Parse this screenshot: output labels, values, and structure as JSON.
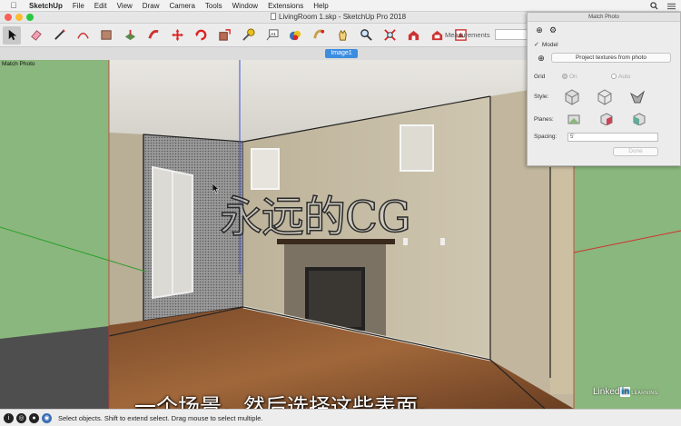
{
  "menubar": {
    "app_name": "SketchUp",
    "items": [
      "File",
      "Edit",
      "View",
      "Draw",
      "Camera",
      "Tools",
      "Window",
      "Extensions",
      "Help"
    ]
  },
  "window": {
    "title": "LivingRoom 1.skp - SketchUp Pro 2018"
  },
  "toolbar": {
    "tools": [
      "select-icon",
      "eraser-icon",
      "pencil-icon",
      "arc-icon",
      "rectangle-icon",
      "push-pull-icon",
      "follow-me-icon",
      "move-icon",
      "rotate-icon",
      "scale-icon",
      "tape-measure-icon",
      "text-icon",
      "paint-bucket-icon",
      "orbit-icon",
      "pan-icon",
      "zoom-icon",
      "zoom-extents-icon",
      "warehouse-icon",
      "extension-warehouse-icon",
      "layout-icon"
    ],
    "measurements_label": "Measurements"
  },
  "scene_tab": {
    "label": "Image1"
  },
  "viewport": {
    "label": "Match Photo",
    "watermark": "永远的CG",
    "subtitle": "一个场景，然后选择这些表面。",
    "brand": {
      "part1": "Linked",
      "part2": "in",
      "part3": "LEARNING"
    }
  },
  "match_photo_panel": {
    "title": "Match Photo",
    "model_label": "Model",
    "model_checked": true,
    "project_textures_label": "Project textures from photo",
    "grid_label": "Grid",
    "grid_on_label": "On",
    "grid_auto_label": "Auto",
    "style_label": "Style:",
    "planes_label": "Planes:",
    "spacing_label": "Spacing:",
    "spacing_value": "5'",
    "done_label": "Done"
  },
  "statusbar": {
    "text": "Select objects. Shift to extend select. Drag mouse to select multiple."
  },
  "colors": {
    "ground_green": "#8ab77d",
    "scene_tab_blue": "#3b8de0",
    "close": "#fc5f57",
    "minimize": "#fdbc2e",
    "maximize": "#2ac840"
  }
}
